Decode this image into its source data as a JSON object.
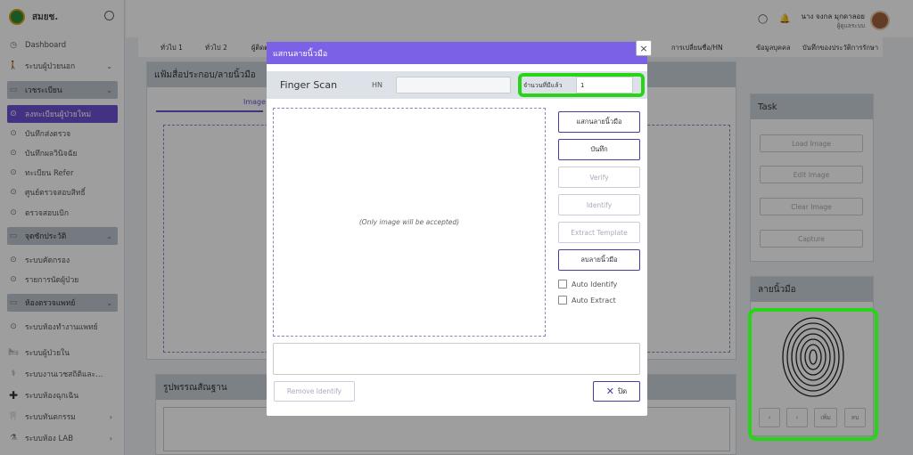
{
  "app": {
    "logo_text": "สมยช."
  },
  "sidebar": {
    "items": [
      {
        "label": "Dashboard",
        "icon": "clock-icon"
      },
      {
        "label": "ระบบผู้ป่วยนอก",
        "icon": "walking-person-icon"
      },
      {
        "label": "เวชระเบียน",
        "icon": "monitor-icon"
      },
      {
        "label": "ลงทะเบียนผู้ป่วยใหม่",
        "icon": "radio-dot-icon"
      },
      {
        "label": "บันทึกส่งตรวจ",
        "icon": "radio-dot-icon"
      },
      {
        "label": "บันทึกผลวินิจฉัย",
        "icon": "radio-dot-icon"
      },
      {
        "label": "ทะเบียน Refer",
        "icon": "radio-dot-icon"
      },
      {
        "label": "ศูนย์ตรวจสอบสิทธิ์",
        "icon": "radio-dot-icon"
      },
      {
        "label": "ตรวจสอบเบิก",
        "icon": "radio-dot-icon"
      },
      {
        "label": "จุดซักประวัติ",
        "icon": "monitor-icon"
      },
      {
        "label": "ระบบคัดกรอง",
        "icon": "radio-dot-icon"
      },
      {
        "label": "รายการนัดผู้ป่วย",
        "icon": "radio-dot-icon"
      },
      {
        "label": "ห้องตรวจแพทย์",
        "icon": "monitor-icon"
      },
      {
        "label": "ระบบห้องทำงานแพทย์",
        "icon": "radio-dot-icon"
      },
      {
        "label": "ระบบผู้ป่วยใน",
        "icon": "hospital-bed-icon"
      },
      {
        "label": "ระบบงานเวชสถิติและ...",
        "icon": "stats-icon"
      },
      {
        "label": "ระบบห้องฉุกเฉิน",
        "icon": "plus-cross-icon"
      },
      {
        "label": "ระบบทันตกรรม",
        "icon": "tooth-icon"
      },
      {
        "label": "ระบบห้อง LAB",
        "icon": "flask-icon"
      }
    ]
  },
  "header": {
    "user_name": "นาง จงกล มุกดาลอย",
    "user_role": "ผู้ดูแลระบบ"
  },
  "tabs": [
    "ทั่วไป 1",
    "ทั่วไป 2",
    "ผู้ติดต",
    "การเปลี่ยนชื่อ/HN",
    "ข้อมูลบุคคล",
    "บันทึกของประวัติการรักษา"
  ],
  "page": {
    "panel_title": "แฟ้มสื่อประกอบ/ลายนิ้วมือ",
    "image_tab": "Image",
    "photo_title": "รูปพรรณสัณฐาน",
    "task": {
      "title": "Task",
      "buttons": [
        "Load Image",
        "Edit Image",
        "Clear Image",
        "Capture"
      ]
    },
    "fingerprint_panel": {
      "title": "ลายนิ้วมือ",
      "nav": [
        "‹",
        "›",
        "เพิ่ม",
        "ลบ"
      ]
    }
  },
  "modal": {
    "title": "แสกนลายนิ้วมือ",
    "finger_scan_label": "Finger Scan",
    "hn_label": "HN",
    "hn_value": "",
    "count_label": "จำนวนที่มีแล้ว",
    "count_value": "1",
    "drop_hint": "(Only image will be accepted)",
    "actions": [
      "แสกนลายนิ้วมือ",
      "บันทึก",
      "Verify",
      "Identify",
      "Extract Template",
      "ลบลายนิ้วมือ"
    ],
    "checkboxes": [
      "Auto Identify",
      "Auto Extract"
    ],
    "remove_identify": "Remove Identify",
    "close_label": "ปิด"
  }
}
